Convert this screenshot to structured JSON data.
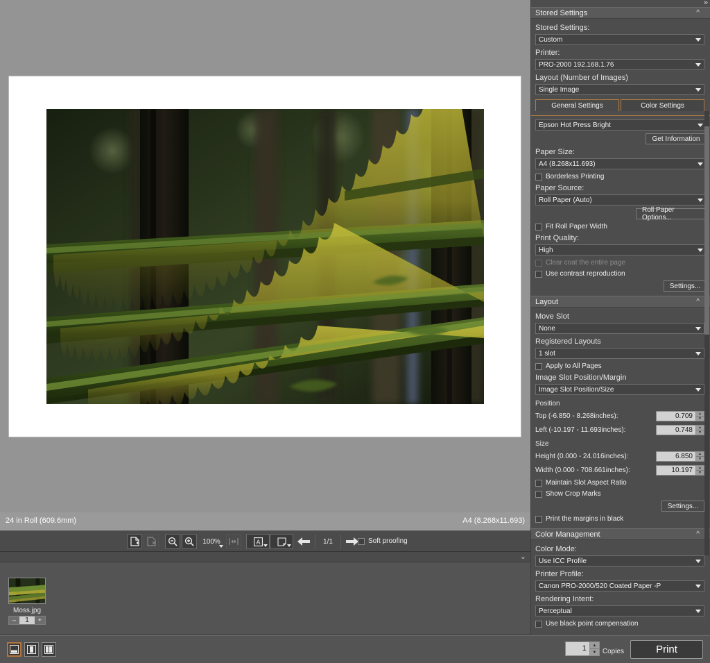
{
  "preview": {
    "status_left": "24 in Roll (609.6mm)",
    "status_right": "A4 (8.268x11.693)"
  },
  "toolbar": {
    "add_page_icon": "add-page-icon",
    "delete_page_icon": "delete-page-icon",
    "zoom_out_icon": "zoom-out-icon",
    "zoom_in_icon": "zoom-in-icon",
    "zoom_level": "100%",
    "fit_icon": "fit-to-window-icon",
    "text_tool_icon": "text-annotation-icon",
    "page_tool_icon": "page-options-icon",
    "prev_icon": "previous-page-icon",
    "next_icon": "next-page-icon",
    "page_indicator": "1/1",
    "soft_proofing_label": "Soft proofing",
    "soft_proofing_checked": false
  },
  "thumbstrip": {
    "item_name": "Moss.jpg",
    "copies_value": "1",
    "minus_label": "–",
    "plus_label": "+"
  },
  "viewmodes": {
    "single_view_icon": "single-preview-view-icon",
    "split_view_icon": "split-preview-view-icon",
    "dual_view_icon": "dual-preview-view-icon",
    "active_index": 0
  },
  "bottombar": {
    "copies_value": "1",
    "copies_label": "Copies",
    "print_label": "Print"
  },
  "panel": {
    "expand_icon": "expand-panel-icon",
    "stored_settings": {
      "header": "Stored Settings",
      "collapse_icon": "collapse-section-icon",
      "stored_settings_label": "Stored Settings:",
      "stored_settings_value": "Custom",
      "printer_label": "Printer:",
      "printer_value": "PRO-2000 192.168.1.76",
      "layout_label": "Layout (Number of Images)",
      "layout_value": "Single Image"
    },
    "tabs": {
      "general": "General Settings",
      "color": "Color Settings",
      "active": "General Settings"
    },
    "general": {
      "media_value": "Epson Hot Press Bright",
      "get_information_label": "Get Information",
      "paper_size_label": "Paper Size:",
      "paper_size_value": "A4 (8.268x11.693)",
      "borderless_label": "Borderless Printing",
      "borderless_checked": false,
      "paper_source_label": "Paper Source:",
      "paper_source_value": "Roll Paper (Auto)",
      "roll_paper_options_label": "Roll Paper Options...",
      "fit_roll_label": "Fit Roll Paper Width",
      "fit_roll_checked": false,
      "print_quality_label": "Print Quality:",
      "print_quality_value": "High",
      "clear_coat_label": "Clear coat the entire page",
      "clear_coat_checked": false,
      "clear_coat_disabled": true,
      "contrast_label": "Use contrast reproduction",
      "contrast_checked": false,
      "settings_label": "Settings..."
    },
    "layout": {
      "header": "Layout",
      "collapse_icon": "collapse-section-icon",
      "move_slot_label": "Move Slot",
      "move_slot_value": "None",
      "registered_layouts_label": "Registered Layouts",
      "registered_layouts_value": "1 slot",
      "apply_all_label": "Apply to All Pages",
      "apply_all_checked": false,
      "slot_position_label": "Image Slot Position/Margin",
      "slot_position_value": "Image Slot Position/Size",
      "position_title": "Position",
      "top_label": "Top (-6.850 - 8.268inches):",
      "top_value": "0.709",
      "left_label": "Left (-10.197 - 11.693inches):",
      "left_value": "0.748",
      "size_title": "Size",
      "height_label": "Height (0.000 - 24.016inches):",
      "height_value": "6.850",
      "width_label": "Width (0.000 - 708.661inches):",
      "width_value": "10.197",
      "maintain_ratio_label": "Maintain Slot Aspect Ratio",
      "maintain_ratio_checked": false,
      "crop_marks_label": "Show Crop Marks",
      "crop_marks_checked": false,
      "settings_label": "Settings...",
      "margins_black_label": "Print the margins in black",
      "margins_black_checked": false
    },
    "color_management": {
      "header": "Color Management",
      "collapse_icon": "collapse-section-icon",
      "color_mode_label": "Color Mode:",
      "color_mode_value": "Use ICC Profile",
      "printer_profile_label": "Printer Profile:",
      "printer_profile_value": "Canon PRO-2000/520 Coated Paper -P",
      "rendering_intent_label": "Rendering Intent:",
      "rendering_intent_value": "Perceptual",
      "black_point_label": "Use black point compensation",
      "black_point_checked": false
    }
  },
  "colors": {
    "panel_bg": "#4d4d4d",
    "section_header_bg": "#5a5a5a",
    "preview_bg": "#949494",
    "paper_white": "#ffffff",
    "tab_accent": "#b07a42",
    "bottom_bar_bg": "#545454",
    "field_bg": "#d2d2d2"
  }
}
